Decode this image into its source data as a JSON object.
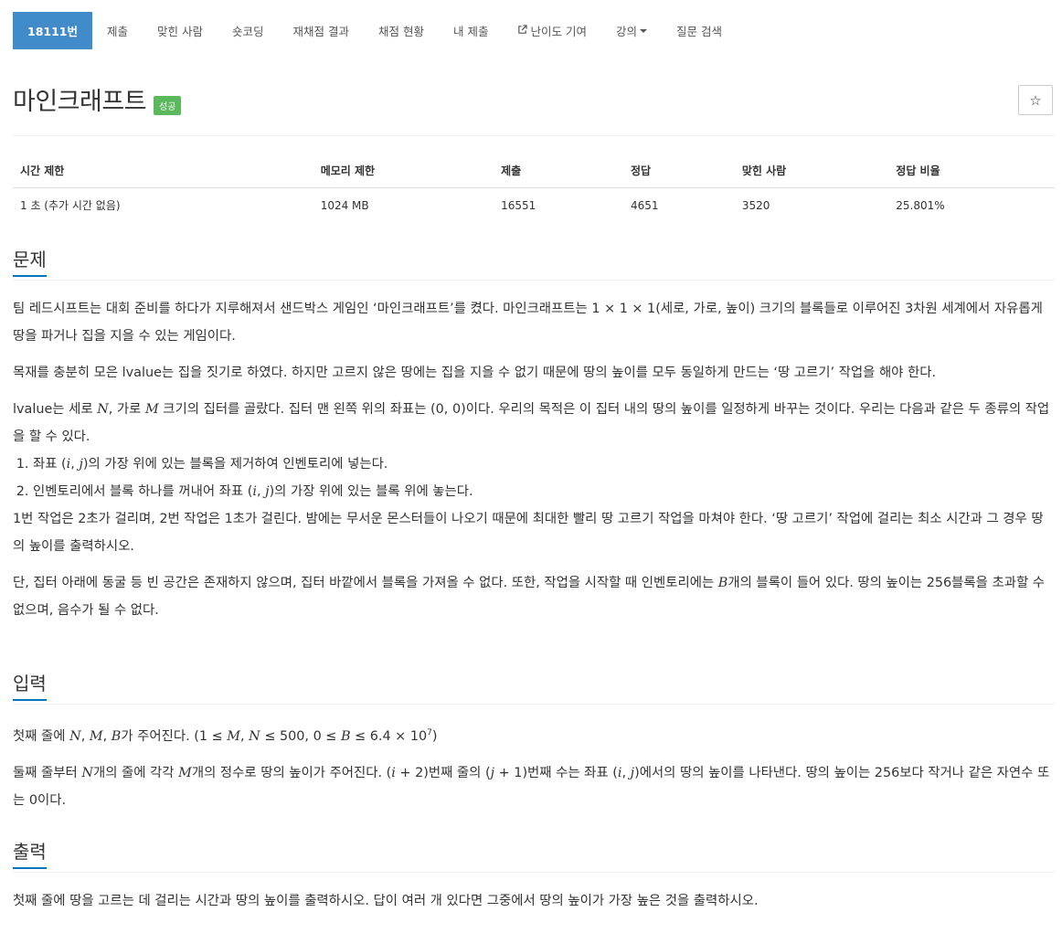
{
  "nav": [
    {
      "label": "18111번",
      "active": true
    },
    {
      "label": "제출"
    },
    {
      "label": "맞힌 사람"
    },
    {
      "label": "숏코딩"
    },
    {
      "label": "재채점 결과"
    },
    {
      "label": "채점 현황"
    },
    {
      "label": "내 제출"
    },
    {
      "label": "난이도 기여",
      "icon": "external-link-icon"
    },
    {
      "label": "강의",
      "dropdown": true
    },
    {
      "label": "질문 검색"
    }
  ],
  "problem": {
    "title": "마인크래프트",
    "badge": "성공",
    "star": "☆"
  },
  "info": {
    "headers": [
      "시간 제한",
      "메모리 제한",
      "제출",
      "정답",
      "맞힌 사람",
      "정답 비율"
    ],
    "values": [
      "1 초 (추가 시간 없음)",
      "1024 MB",
      "16551",
      "4651",
      "3520",
      "25.801%"
    ]
  },
  "sections": {
    "problem_title": "문제",
    "problem_p1": "팀 레드시프트는 대회 준비를 하다가 지루해져서 샌드박스 게임인 ‘마인크래프트’를 켰다. 마인크래프트는 1 × 1 × 1(세로, 가로, 높이) 크기의 블록들로 이루어진 3차원 세계에서 자유롭게 땅을 파거나 집을 지을 수 있는 게임이다.",
    "problem_p2": "목재를 충분히 모은 lvalue는 집을 짓기로 하였다. 하지만 고르지 않은 땅에는 집을 지을 수 없기 때문에 땅의 높이를 모두 동일하게 만드는 ‘땅 고르기’ 작업을 해야 한다.",
    "problem_p3_a": "lvalue는 세로 ",
    "N": "N",
    "M": "M",
    "B": "B",
    "i": "i",
    "j": "j",
    "problem_p3_b": ", 가로 ",
    "problem_p3_c": " 크기의 집터를 골랐다. 집터 맨 왼쪽 위의 좌표는 (0, 0)이다. 우리의 목적은 이 집터 내의 땅의 높이를 일정하게 바꾸는 것이다. 우리는 다음과 같은 두 종류의 작업을 할 수 있다.",
    "step1_a": "좌표 (",
    "step1_b": ", ",
    "step1_c": ")의 가장 위에 있는 블록을 제거하여 인벤토리에 넣는다.",
    "step2_a": "인벤토리에서 블록 하나를 꺼내어 좌표 (",
    "step2_b": ", ",
    "step2_c": ")의 가장 위에 있는 블록 위에 놓는다.",
    "problem_p4": "1번 작업은 2초가 걸리며, 2번 작업은 1초가 걸린다. 밤에는 무서운 몬스터들이 나오기 때문에 최대한 빨리 땅 고르기 작업을 마쳐야 한다. ‘땅 고르기’ 작업에 걸리는 최소 시간과 그 경우 땅의 높이를 출력하시오.",
    "problem_p5_a": "단, 집터 아래에 동굴 등 빈 공간은 존재하지 않으며, 집터 바깥에서 블록을 가져올 수 없다. 또한, 작업을 시작할 때 인벤토리에는 ",
    "problem_p5_b": "개의 블록이 들어 있다. 땅의 높이는 256블록을 초과할 수 없으며, 음수가 될 수 없다.",
    "input_title": "입력",
    "input_p1_a": "첫째 줄에 ",
    "input_p1_sep1": ", ",
    "input_p1_sep2": ", ",
    "input_p1_b": "가 주어진다. (1 ≤ ",
    "input_p1_sep3": ", ",
    "input_p1_c": " ≤ 500, 0 ≤ ",
    "input_p1_d": " ≤ 6.4 × 10",
    "input_p1_sup": "7",
    "input_p1_e": ")",
    "input_p2_a": "둘째 줄부터 ",
    "input_p2_b": "개의 줄에 각각 ",
    "input_p2_c": "개의 정수로 땅의 높이가 주어진다. (",
    "input_p2_d": " + 2)번째 줄의 (",
    "input_p2_e": " + 1)번째 수는 좌표 (",
    "input_p2_f": ", ",
    "input_p2_g": ")에서의 땅의 높이를 나타낸다. 땅의 높이는 256보다 작거나 같은 자연수 또는 0이다.",
    "output_title": "출력",
    "output_p1": "첫째 줄에 땅을 고르는 데 걸리는 시간과 땅의 높이를 출력하시오. 답이 여러 개 있다면 그중에서 땅의 높이가 가장 높은 것을 출력하시오."
  },
  "colors": {
    "nav_active": "#428bca",
    "badge": "#5cb85c",
    "section_underline": "#0076c0"
  }
}
